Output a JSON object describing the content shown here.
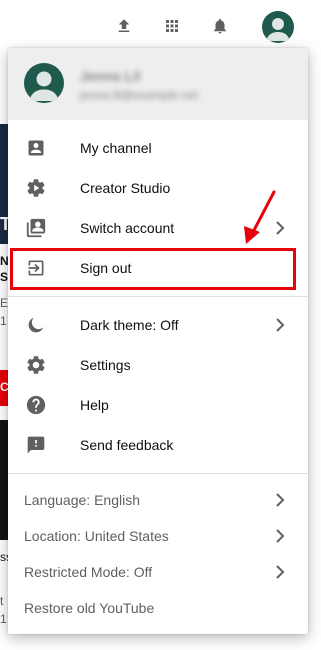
{
  "account": {
    "name": "Jenna Lil",
    "email": "jenna.lil@example.net"
  },
  "menu": {
    "items": [
      {
        "label": "My channel",
        "icon": "person-box-icon"
      },
      {
        "label": "Creator Studio",
        "icon": "gear-icon"
      },
      {
        "label": "Switch account",
        "icon": "switch-account-icon"
      },
      {
        "label": "Sign out",
        "icon": "sign-out-icon"
      },
      {
        "label": "Dark theme: Off",
        "icon": "moon-icon"
      },
      {
        "label": "Settings",
        "icon": "gear-icon"
      },
      {
        "label": "Help",
        "icon": "help-icon"
      },
      {
        "label": "Send feedback",
        "icon": "feedback-icon"
      }
    ],
    "footer": [
      {
        "label": "Language: English"
      },
      {
        "label": "Location: United States"
      },
      {
        "label": "Restricted Mode: Off"
      },
      {
        "label": "Restore old YouTube"
      }
    ]
  },
  "background": {
    "fragments": [
      "N:",
      "S",
      "E",
      "1",
      "CI",
      "ss",
      "t",
      "1",
      "T"
    ]
  },
  "colors": {
    "accent": "#e8000b",
    "avatar": "#1f5a4c",
    "header_bg": "#eeeeee",
    "icon": "#606060"
  }
}
